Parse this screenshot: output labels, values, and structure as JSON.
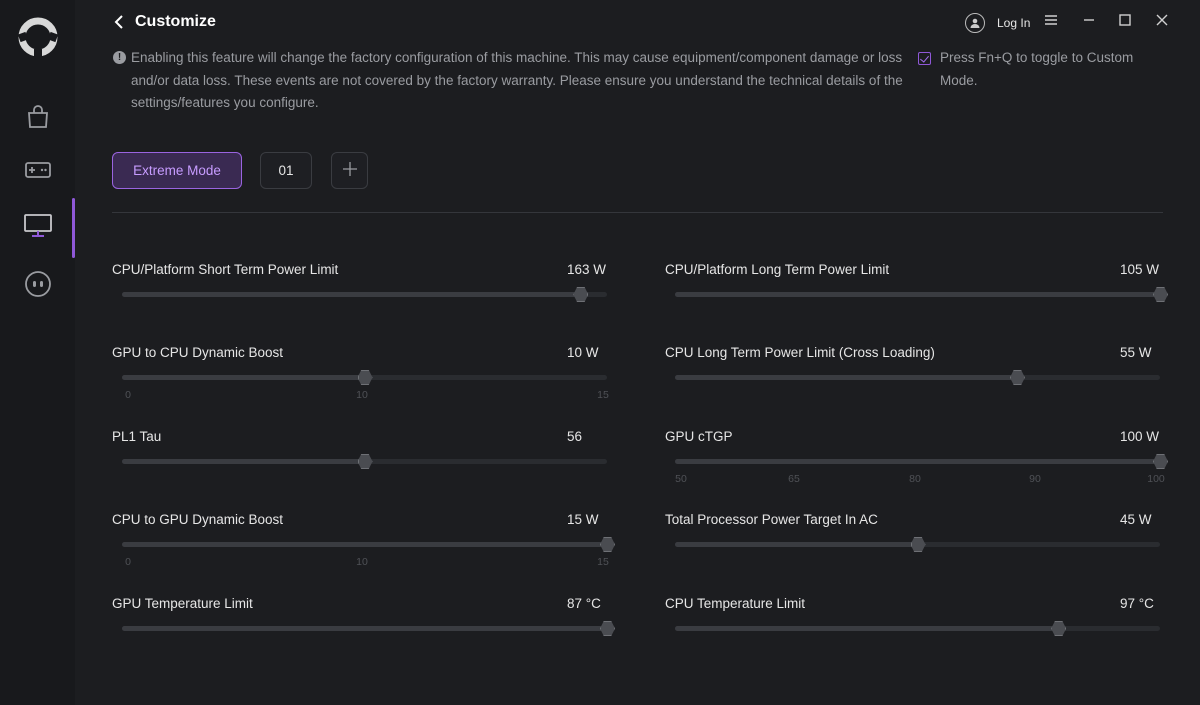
{
  "header": {
    "title": "Customize",
    "login_label": "Log In"
  },
  "notice": {
    "text": "Enabling this feature will change the factory configuration of this machine. This may cause equipment/component damage or loss and/or data loss. These events are not covered by the factory warranty. Please ensure you understand the technical details of the settings/features you configure."
  },
  "fnq": {
    "label": "Press Fn+Q to toggle to Custom Mode.",
    "checked": true
  },
  "modes": {
    "active_label": "Extreme Mode",
    "profile_label": "01",
    "add_label": "+"
  },
  "colors": {
    "accent": "#8f58d8",
    "background": "#1c1d20",
    "sidebar": "#18191c"
  },
  "sliders": {
    "cpu_short_term": {
      "label": "CPU/Platform Short Term Power Limit",
      "value": "163 W",
      "fraction": 0.945
    },
    "cpu_long_term": {
      "label": "CPU/Platform Long Term Power Limit",
      "value": "105 W",
      "fraction": 1.0
    },
    "gpu_to_cpu_boost": {
      "label": "GPU to CPU Dynamic Boost",
      "value": "10 W",
      "fraction": 0.5,
      "ticks": [
        "0",
        "10",
        "15"
      ]
    },
    "cpu_long_term_cross": {
      "label": "CPU Long Term Power Limit (Cross Loading)",
      "value": "55 W",
      "fraction": 0.705
    },
    "pl1_tau": {
      "label": "PL1 Tau",
      "value": "56",
      "fraction": 0.5
    },
    "gpu_ctgp": {
      "label": "GPU cTGP",
      "value": "100 W",
      "fraction": 1.0,
      "ticks": [
        "50",
        "65",
        "80",
        "90",
        "100"
      ]
    },
    "cpu_to_gpu_boost": {
      "label": "CPU to GPU Dynamic Boost",
      "value": "15 W",
      "fraction": 1.0,
      "ticks": [
        "0",
        "10",
        "15"
      ]
    },
    "total_processor_ac": {
      "label": "Total Processor Power Target In AC",
      "value": "45 W",
      "fraction": 0.5
    },
    "gpu_temp": {
      "label": "GPU Temperature Limit",
      "value": "87 °C",
      "fraction": 1.0
    },
    "cpu_temp": {
      "label": "CPU Temperature Limit",
      "value": "97 °C",
      "fraction": 0.79
    }
  }
}
